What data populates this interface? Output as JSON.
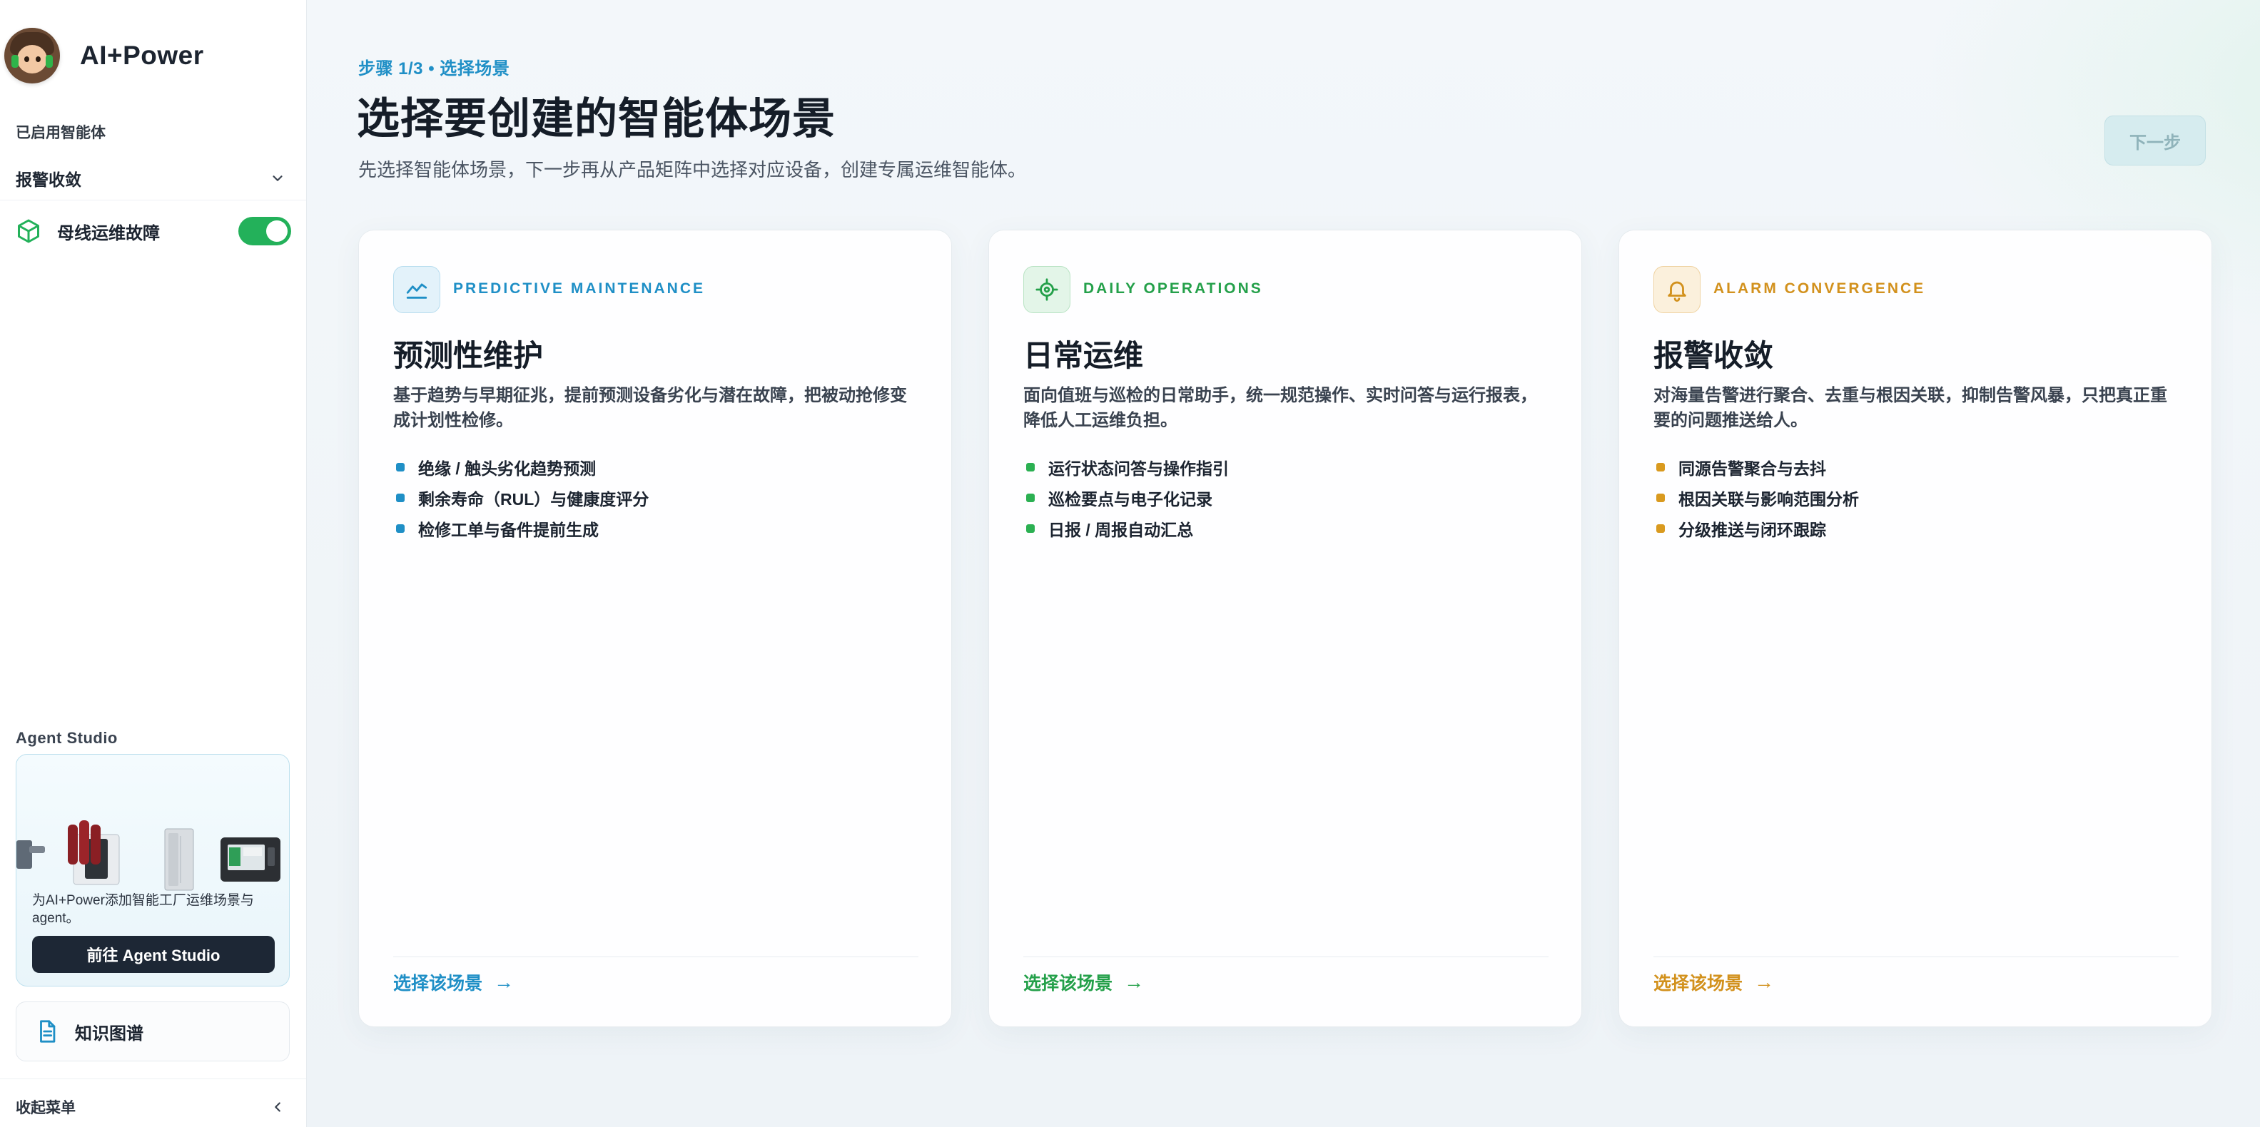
{
  "app": {
    "title": "AI+Power"
  },
  "sidebar": {
    "enabled_label": "已启用智能体",
    "group": {
      "label": "报警收敛"
    },
    "agent": {
      "label": "母线运维故障",
      "enabled": true
    },
    "studio": {
      "label": "Agent Studio",
      "description": "为AI+Power添加智能工厂运维场景与agent。",
      "button": "前往 Agent Studio"
    },
    "knowledge_graph": {
      "label": "知识图谱"
    },
    "collapse": {
      "label": "收起菜单"
    }
  },
  "header": {
    "step": "步骤 1/3 • 选择场景",
    "title": "选择要创建的智能体场景",
    "subtitle": "先选择智能体场景，下一步再从产品矩阵中选择对应设备，创建专属运维智能体。",
    "next_button": "下一步"
  },
  "cards": [
    {
      "tag": "PREDICTIVE MAINTENANCE",
      "title": "预测性维护",
      "description": "基于趋势与早期征兆，提前预测设备劣化与潜在故障，把被动抢修变成计划性检修。",
      "features": [
        "绝缘 / 触头劣化趋势预测",
        "剩余寿命（RUL）与健康度评分",
        "检修工单与备件提前生成"
      ],
      "cta": "选择该场景",
      "icon": "trend-chart-icon",
      "color": "#1f8fc6"
    },
    {
      "tag": "DAILY OPERATIONS",
      "title": "日常运维",
      "description": "面向值班与巡检的日常助手，统一规范操作、实时问答与运行报表，降低人工运维负担。",
      "features": [
        "运行状态问答与操作指引",
        "巡检要点与电子化记录",
        "日报 / 周报自动汇总"
      ],
      "cta": "选择该场景",
      "icon": "target-icon",
      "color": "#24a04a"
    },
    {
      "tag": "ALARM CONVERGENCE",
      "title": "报警收敛",
      "description": "对海量告警进行聚合、去重与根因关联，抑制告警风暴，只把真正重要的问题推送给人。",
      "features": [
        "同源告警聚合与去抖",
        "根因关联与影响范围分析",
        "分级推送与闭环跟踪"
      ],
      "cta": "选择该场景",
      "icon": "bell-icon",
      "color": "#d2911d"
    }
  ]
}
